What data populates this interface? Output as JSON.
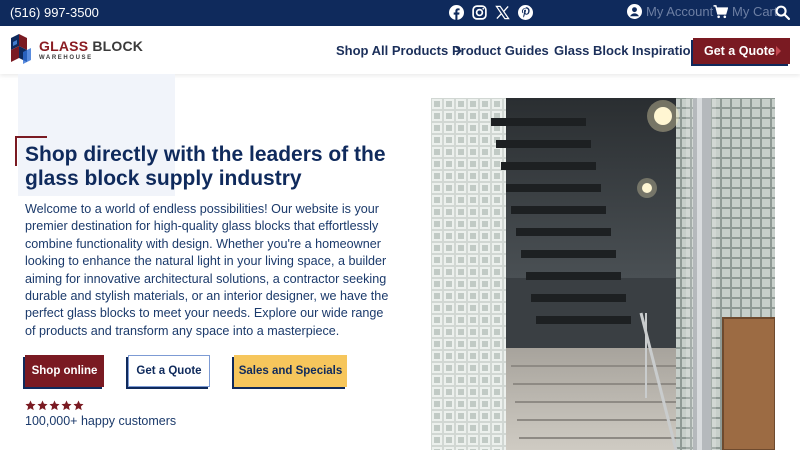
{
  "topbar": {
    "phone": "(516) 997-3500",
    "social_icons": [
      "facebook-icon",
      "instagram-icon",
      "x-icon",
      "pinterest-icon"
    ],
    "account_label": "My Account",
    "cart_label": "My Cart"
  },
  "header": {
    "logo": {
      "name_part1": "GLASS",
      "name_part2": "BLOCK",
      "tagline": "WAREHOUSE"
    },
    "nav": {
      "shop_all": "Shop All Products",
      "guides": "Product Guides",
      "inspiration": "Glass Block Inspiration"
    },
    "quote_button": "Get a Quote"
  },
  "hero": {
    "title": "Shop directly with the leaders of the glass block supply industry",
    "body": "Welcome to a world of endless possibilities! Our website is your premier destination for high-quality glass blocks that effortlessly combine functionality with design. Whether you're a homeowner looking to enhance the natural light in your living space, a builder aiming for innovative architectural solutions, a contractor seeking durable and stylish materials, or an interior designer, we have the perfect glass blocks to meet your needs. Explore our wide range of products and transform any space into a masterpiece.",
    "buttons": {
      "shop_online": "Shop online",
      "get_quote": "Get a Quote",
      "sales": "Sales and Specials"
    },
    "rating_stars": 5,
    "customers": "100,000+ happy customers"
  },
  "colors": {
    "navy": "#0f2a5c",
    "maroon": "#7a1a22",
    "gold": "#f6c65c"
  }
}
